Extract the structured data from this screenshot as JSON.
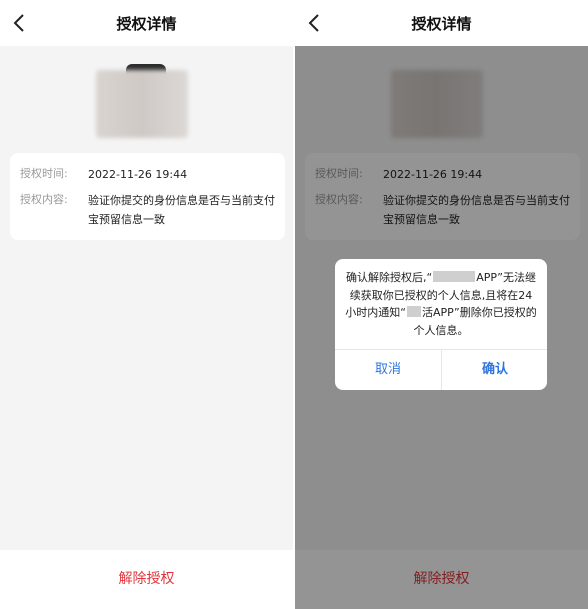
{
  "left": {
    "nav": {
      "title": "授权详情"
    },
    "info": {
      "time_label": "授权时间:",
      "time_value": "2022-11-26 19:44",
      "content_label": "授权内容:",
      "content_value": "验证你提交的身份信息是否与当前支付宝预留信息一致"
    },
    "revoke_label": "解除授权"
  },
  "right": {
    "nav": {
      "title": "授权详情"
    },
    "info": {
      "time_label": "授权时间:",
      "time_value": "2022-11-26 19:44",
      "content_label": "授权内容:",
      "content_value": "验证你提交的身份信息是否与当前支付宝预留信息一致"
    },
    "revoke_label": "解除授权",
    "dialog": {
      "msg_part1": "确认解除授权后,“",
      "msg_part2": "APP”无法继续获取你已授权的个人信息,且将在24小时内通知“",
      "msg_part3": "活APP”删除你已授权的个人信息。",
      "cancel_label": "取消",
      "confirm_label": "确认"
    }
  },
  "colors": {
    "accent_red": "#e0363b",
    "dialog_blue": "#2f74e0"
  }
}
